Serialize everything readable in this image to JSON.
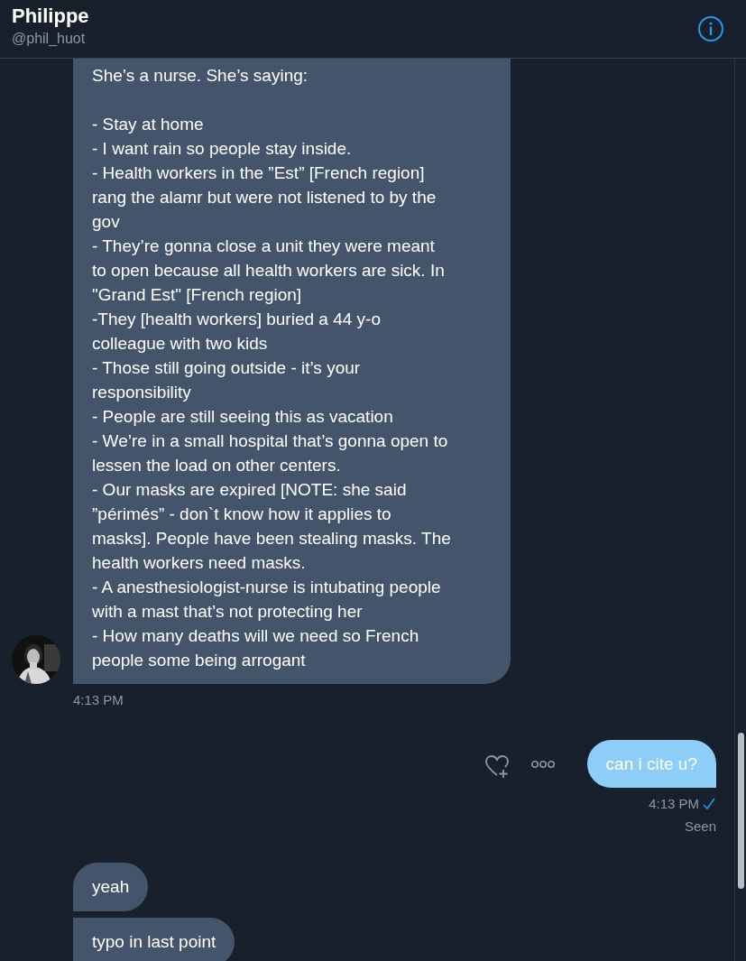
{
  "header": {
    "name": "Philippe",
    "handle": "@phil_huot"
  },
  "received": {
    "paragraphs": [
      [
        "She’s a nurse. She’s saying:"
      ],
      [
        "- Stay at home",
        "- I want rain so people stay inside.",
        "- Health workers in the ”Est” [French region]",
        "rang the alamr but were not listened to by the",
        "gov",
        "- They’re gonna close a unit they were meant",
        "to open because all health workers are sick. In",
        "\"Grand Est\" [French region]",
        "-They [health workers] buried a 44 y-o",
        "colleague with two kids",
        "- Those still going outside - it’s your",
        "responsibility",
        "- People are still seeing this as vacation",
        "- We’re in a small hospital that’s gonna open to",
        "lessen the load on other centers.",
        "- Our masks are expired [NOTE: she said",
        "”périmés” - don`t know how it applies to",
        "masks]. People have been stealing masks. The",
        "health workers need masks.",
        "- A anesthesiologist-nurse is intubating people",
        "with a mast that’s not protecting her",
        "- How many deaths will we need so French",
        "people some being arrogant"
      ]
    ],
    "time": "4:13 PM"
  },
  "sent": {
    "text": "can i cite u?",
    "time": "4:13 PM",
    "seen": "Seen"
  },
  "replies": [
    "yeah",
    "typo in last point"
  ]
}
